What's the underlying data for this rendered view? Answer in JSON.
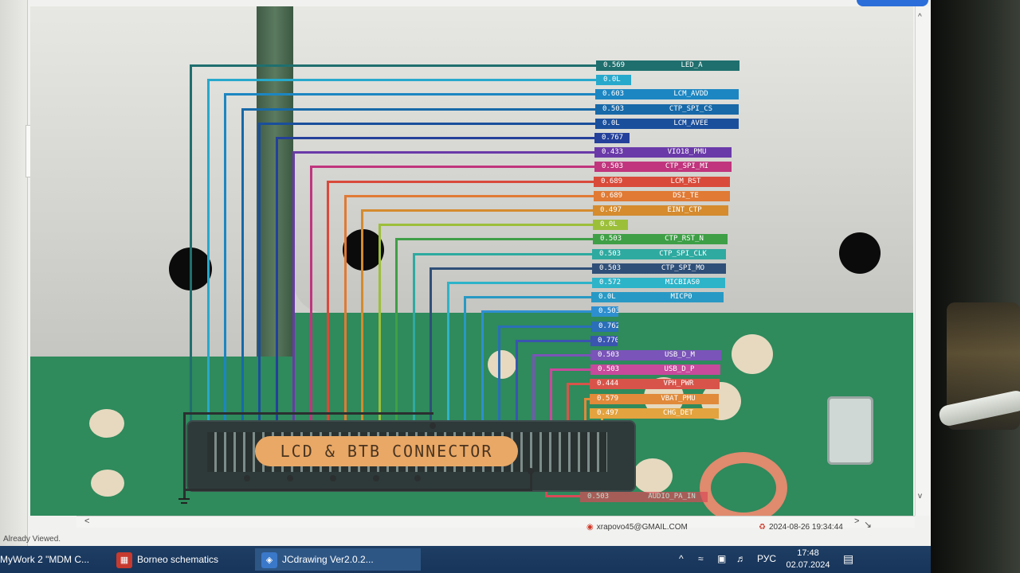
{
  "window": {
    "status_text": "Already Viewed.",
    "author_email": "xrapovo45@GMAIL.COM",
    "timestamp": "2024-08-26 19:34:44"
  },
  "canvas": {
    "connector_label": "LCD & BTB CONNECTOR"
  },
  "signals": [
    {
      "value": "0.569",
      "name": "LED_A",
      "color": "#1f6f6e"
    },
    {
      "value": "0.0L",
      "name": "",
      "color": "#27a9cc"
    },
    {
      "value": "0.603",
      "name": "LCM_AVDD",
      "color": "#1c86c2"
    },
    {
      "value": "0.503",
      "name": "CTP_SPI_CS",
      "color": "#1769a8"
    },
    {
      "value": "0.0L",
      "name": "LCM_AVEE",
      "color": "#1a4f9c"
    },
    {
      "value": "0.767",
      "name": "",
      "color": "#24409a"
    },
    {
      "value": "0.433",
      "name": "VIO18_PMU",
      "color": "#6a3aa8"
    },
    {
      "value": "0.503",
      "name": "CTP_SPI_MI",
      "color": "#c0357d"
    },
    {
      "value": "0.689",
      "name": "LCM_RST",
      "color": "#d94a3a"
    },
    {
      "value": "0.689",
      "name": "DSI_TE",
      "color": "#e07a34"
    },
    {
      "value": "0.497",
      "name": "EINT_CTP",
      "color": "#d58b2e"
    },
    {
      "value": "0.0L",
      "name": "",
      "color": "#9cbf3a"
    },
    {
      "value": "0.503",
      "name": "CTP_RST_N",
      "color": "#3f9f47"
    },
    {
      "value": "0.503",
      "name": "CTP_SPI_CLK",
      "color": "#2eaaa0"
    },
    {
      "value": "0.503",
      "name": "CTP_SPI_MO",
      "color": "#2f4f78"
    },
    {
      "value": "0.572",
      "name": "MICBIAS0",
      "color": "#2db4c9"
    },
    {
      "value": "0.0L",
      "name": "MICP0",
      "color": "#2899c4"
    },
    {
      "value": "0.503",
      "name": "",
      "color": "#2e8fd0"
    },
    {
      "value": "0.762",
      "name": "",
      "color": "#2a6fb8"
    },
    {
      "value": "0.770",
      "name": "",
      "color": "#3a55b0"
    },
    {
      "value": "0.503",
      "name": "USB_D_M",
      "color": "#7a54b8"
    },
    {
      "value": "0.503",
      "name": "USB_D_P",
      "color": "#c84a9c"
    },
    {
      "value": "0.444",
      "name": "VPH_PWR",
      "color": "#d8544a"
    },
    {
      "value": "0.579",
      "name": "VBAT_PMU",
      "color": "#e08a3a"
    },
    {
      "value": "0.497",
      "name": "CHG_DET",
      "color": "#e3a33f"
    }
  ],
  "audio_signal": {
    "value": "0.503",
    "name": "AUDIO_PA_IN",
    "color": "#d94a57"
  },
  "taskbar": {
    "items": [
      {
        "label": "MyWork 2 \"MDM C..."
      },
      {
        "label": "Borneo schematics"
      },
      {
        "label": "JCdrawing Ver2.0.2..."
      }
    ],
    "language": "РУС",
    "time": "17:48",
    "date": "02.07.2024"
  }
}
